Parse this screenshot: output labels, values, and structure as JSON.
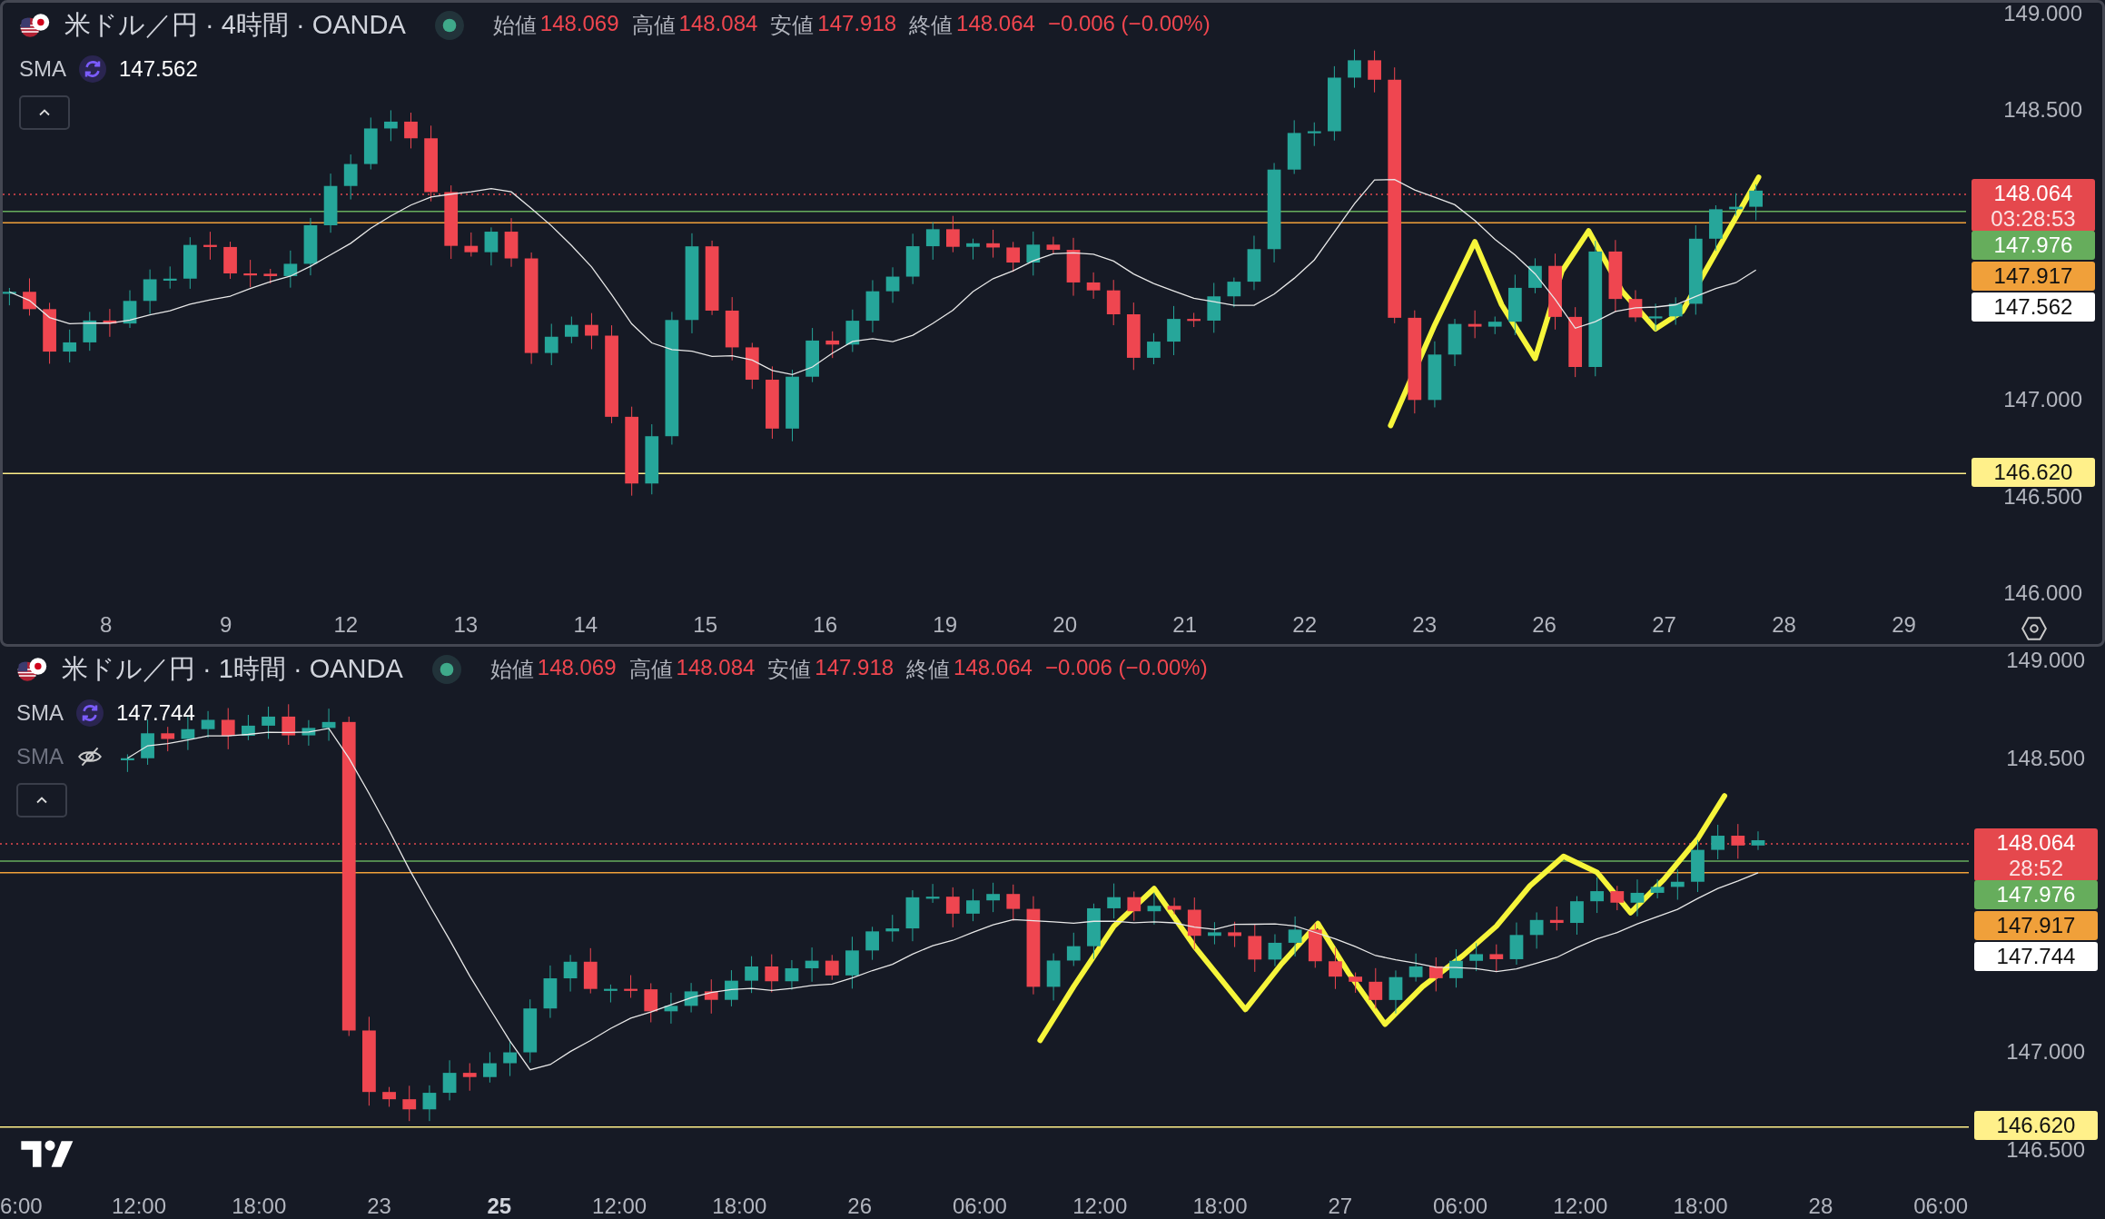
{
  "panes": [
    {
      "legend": {
        "symbol": "米ドル／円 · 4時間 · OANDA",
        "ohlc": [
          {
            "label": "始値",
            "value": "148.069"
          },
          {
            "label": "高値",
            "value": "148.084"
          },
          {
            "label": "安値",
            "value": "147.918"
          },
          {
            "label": "終値",
            "value": "148.064"
          }
        ],
        "change": "−0.006 (−0.00%)",
        "indicators": [
          {
            "label": "SMA",
            "value": "147.562",
            "hidden": false
          }
        ]
      },
      "price_axis": [
        "149.000",
        "148.500",
        "147.000",
        "146.500",
        "146.000"
      ],
      "price_tags": [
        {
          "kind": "last",
          "text": "148.064",
          "countdown": "03:28:53",
          "color": "#e5484d"
        },
        {
          "kind": "level",
          "text": "147.976",
          "color": "#66ad5c"
        },
        {
          "kind": "level",
          "text": "147.917",
          "color": "#f0a03a"
        },
        {
          "kind": "sma",
          "text": "147.562",
          "color": "#ffffff"
        },
        {
          "kind": "level",
          "text": "146.620",
          "color": "#fff08a"
        }
      ],
      "time_axis": [
        {
          "text": "8",
          "bold": false
        },
        {
          "text": "9",
          "bold": false
        },
        {
          "text": "12",
          "bold": false
        },
        {
          "text": "13",
          "bold": false
        },
        {
          "text": "14",
          "bold": false
        },
        {
          "text": "15",
          "bold": false
        },
        {
          "text": "16",
          "bold": false
        },
        {
          "text": "19",
          "bold": false
        },
        {
          "text": "20",
          "bold": false
        },
        {
          "text": "21",
          "bold": false
        },
        {
          "text": "22",
          "bold": false
        },
        {
          "text": "23",
          "bold": false
        },
        {
          "text": "26",
          "bold": false
        },
        {
          "text": "27",
          "bold": false
        },
        {
          "text": "28",
          "bold": false
        },
        {
          "text": "29",
          "bold": false
        }
      ]
    },
    {
      "legend": {
        "symbol": "米ドル／円 · 1時間 · OANDA",
        "ohlc": [
          {
            "label": "始値",
            "value": "148.069"
          },
          {
            "label": "高値",
            "value": "148.084"
          },
          {
            "label": "安値",
            "value": "147.918"
          },
          {
            "label": "終値",
            "value": "148.064"
          }
        ],
        "change": "−0.006 (−0.00%)",
        "indicators": [
          {
            "label": "SMA",
            "value": "147.744",
            "hidden": false
          },
          {
            "label": "SMA",
            "hidden": true
          }
        ]
      },
      "price_axis": [
        "149.000",
        "148.500",
        "147.000",
        "146.500"
      ],
      "price_tags": [
        {
          "kind": "last",
          "text": "148.064",
          "countdown": "28:52",
          "color": "#e5484d"
        },
        {
          "kind": "level",
          "text": "147.976",
          "color": "#66ad5c"
        },
        {
          "kind": "level",
          "text": "147.917",
          "color": "#f0a03a"
        },
        {
          "kind": "sma",
          "text": "147.744",
          "color": "#ffffff"
        },
        {
          "kind": "level",
          "text": "146.620",
          "color": "#fff08a"
        }
      ],
      "time_axis": [
        {
          "text": "6:00",
          "bold": false
        },
        {
          "text": "12:00",
          "bold": false
        },
        {
          "text": "18:00",
          "bold": false
        },
        {
          "text": "23",
          "bold": false
        },
        {
          "text": "25",
          "bold": true
        },
        {
          "text": "12:00",
          "bold": false
        },
        {
          "text": "18:00",
          "bold": false
        },
        {
          "text": "26",
          "bold": false
        },
        {
          "text": "06:00",
          "bold": false
        },
        {
          "text": "12:00",
          "bold": false
        },
        {
          "text": "18:00",
          "bold": false
        },
        {
          "text": "27",
          "bold": false
        },
        {
          "text": "06:00",
          "bold": false
        },
        {
          "text": "12:00",
          "bold": false
        },
        {
          "text": "18:00",
          "bold": false
        },
        {
          "text": "28",
          "bold": false
        },
        {
          "text": "06:00",
          "bold": false
        }
      ]
    }
  ]
}
